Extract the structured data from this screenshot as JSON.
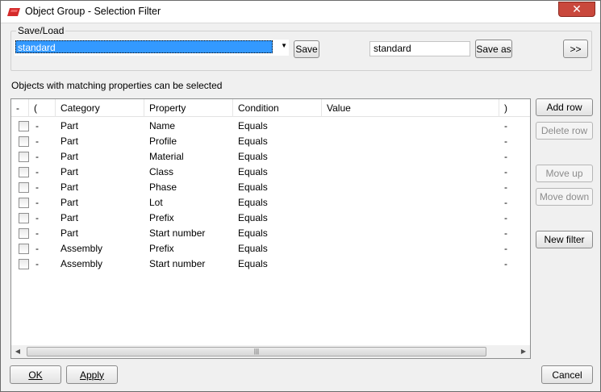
{
  "window": {
    "title": "Object Group - Selection Filter"
  },
  "save_load": {
    "legend": "Save/Load",
    "selected_filter": "standard",
    "save_label": "Save",
    "save_as_value": "standard",
    "save_as_label": "Save as",
    "more_label": ">>"
  },
  "info_text": "Objects with matching properties can be selected",
  "table": {
    "headers": {
      "minus": "-",
      "open_paren": "(",
      "category": "Category",
      "property": "Property",
      "condition": "Condition",
      "value": "Value",
      "close_paren": ")"
    },
    "rows": [
      {
        "minus": "-",
        "category": "Part",
        "property": "Name",
        "condition": "Equals",
        "value": "",
        "close": "-"
      },
      {
        "minus": "-",
        "category": "Part",
        "property": "Profile",
        "condition": "Equals",
        "value": "",
        "close": "-"
      },
      {
        "minus": "-",
        "category": "Part",
        "property": "Material",
        "condition": "Equals",
        "value": "",
        "close": "-"
      },
      {
        "minus": "-",
        "category": "Part",
        "property": "Class",
        "condition": "Equals",
        "value": "",
        "close": "-"
      },
      {
        "minus": "-",
        "category": "Part",
        "property": "Phase",
        "condition": "Equals",
        "value": "",
        "close": "-"
      },
      {
        "minus": "-",
        "category": "Part",
        "property": "Lot",
        "condition": "Equals",
        "value": "",
        "close": "-"
      },
      {
        "minus": "-",
        "category": "Part",
        "property": "Prefix",
        "condition": "Equals",
        "value": "",
        "close": "-"
      },
      {
        "minus": "-",
        "category": "Part",
        "property": "Start number",
        "condition": "Equals",
        "value": "",
        "close": "-"
      },
      {
        "minus": "-",
        "category": "Assembly",
        "property": "Prefix",
        "condition": "Equals",
        "value": "",
        "close": "-"
      },
      {
        "minus": "-",
        "category": "Assembly",
        "property": "Start number",
        "condition": "Equals",
        "value": "",
        "close": "-"
      }
    ]
  },
  "side_buttons": {
    "add_row": "Add row",
    "delete_row": "Delete row",
    "move_up": "Move up",
    "move_down": "Move down",
    "new_filter": "New filter"
  },
  "bottom": {
    "ok": "OK",
    "apply": "Apply",
    "cancel": "Cancel"
  },
  "colors": {
    "selection": "#3399ff",
    "close_button": "#c9483c",
    "app_icon": "#d42a2a"
  }
}
